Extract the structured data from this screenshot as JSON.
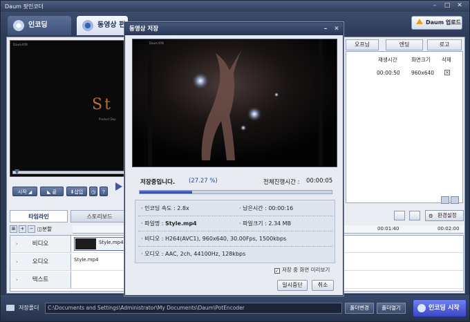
{
  "window": {
    "title": "Daum 팟인코더"
  },
  "tabs": {
    "encoding": "인코딩",
    "edit": "동영상 편"
  },
  "upload_button": "Daum 업로드",
  "preview": {
    "watermark": "Daum KYB",
    "big_text": "St",
    "small_text": "Product Dep"
  },
  "controls": {
    "start": "시작",
    "end": "끝",
    "insert": "삽입",
    "help": "?"
  },
  "right_panel": {
    "tabs": [
      "오프닝",
      "엔딩",
      "로고"
    ],
    "headers": [
      "재생시간",
      "화면크기",
      "삭제"
    ],
    "row": {
      "duration": "00:00:50",
      "size": "960x640",
      "delete": "×"
    }
  },
  "timeline": {
    "tabs": [
      "타임라인",
      "스토리보드"
    ],
    "split_label": "분할",
    "settings_label": "환경설정",
    "ruler": [
      "00:01:40",
      "00:02:00"
    ],
    "tracks": [
      {
        "label": "비디오",
        "clip": "Style.mp4"
      },
      {
        "label": "오디오",
        "clip": "Style.mp4"
      },
      {
        "label": "텍스트",
        "clip": ""
      }
    ]
  },
  "bottom": {
    "save_folder_label": "저장폴더",
    "path": "C:\\Documents and Settings\\Administrator\\My Documents\\Daum\\PotEncoder",
    "change_folder": "폴더변경",
    "open_folder": "폴더열기",
    "start_encoding": "인코딩 시작"
  },
  "modal": {
    "title": "동영상 저장",
    "video_label": "Daum KYB",
    "status_text": "저장중입니다.",
    "percent_text": "(27.27 %)",
    "progress": 0.2727,
    "total_time_label": "전체진행시간 :",
    "total_time": "00:00:05",
    "info": {
      "speed": "인코딩 속도 : 2.8x",
      "remaining": "남은시간 : 00:00:16",
      "filename_label": "파일명 :",
      "filename": "Style.mp4",
      "filesize": "파일크기 : 2.34 MB",
      "video": "비디오 : H264(AVC1), 960x640, 30.00Fps, 1500kbps",
      "audio": "오디오 : AAC, 2ch, 44100Hz, 128kbps"
    },
    "preview_checkbox": "저장 중 화면 미리보기",
    "pause_button": "일시중단",
    "cancel_button": "취소"
  },
  "colors": {
    "accent": "#3b48c4",
    "progress": "#2742b4",
    "frame": "#2b3a55"
  }
}
